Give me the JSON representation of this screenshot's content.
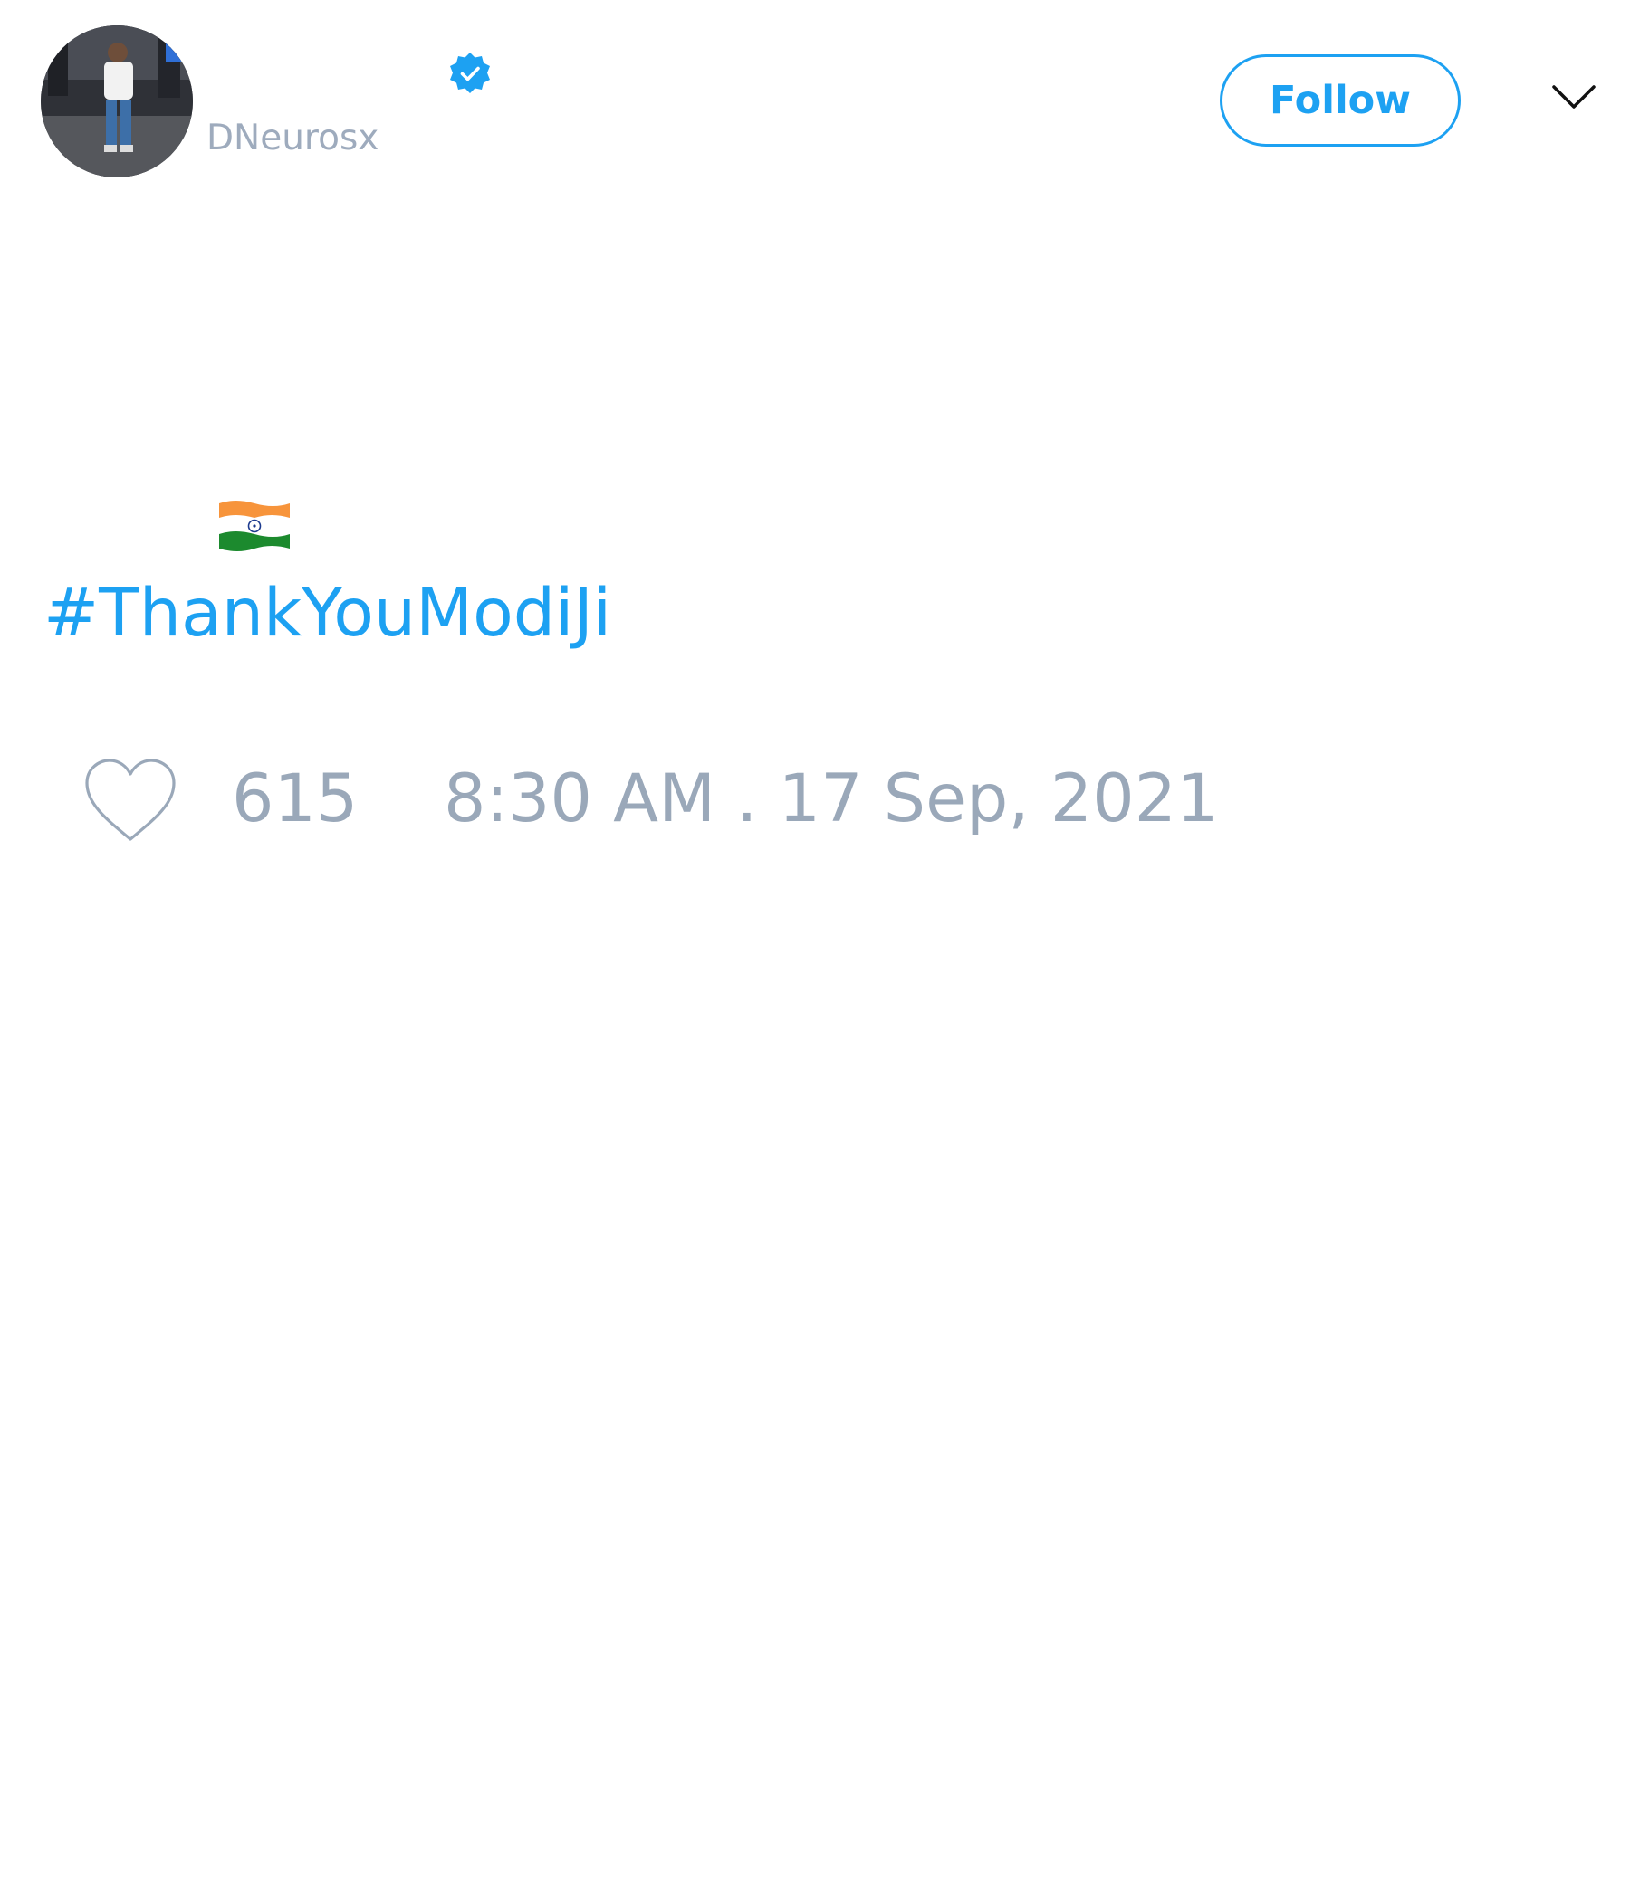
{
  "tweet": {
    "author": {
      "handle": "DNeurosx",
      "verified": true,
      "avatar_icon": "profile-photo"
    },
    "follow_label": "Follow",
    "menu_icon": "chevron-down-icon",
    "body": {
      "emoji": "india-flag",
      "hashtag": "#ThankYouModiJi"
    },
    "like_count": "615",
    "timestamp": "8:30 AM . 17 Sep, 2021"
  },
  "colors": {
    "accent": "#1da1f2",
    "muted_text": "#9aa8b9",
    "background": "#ffffff"
  }
}
